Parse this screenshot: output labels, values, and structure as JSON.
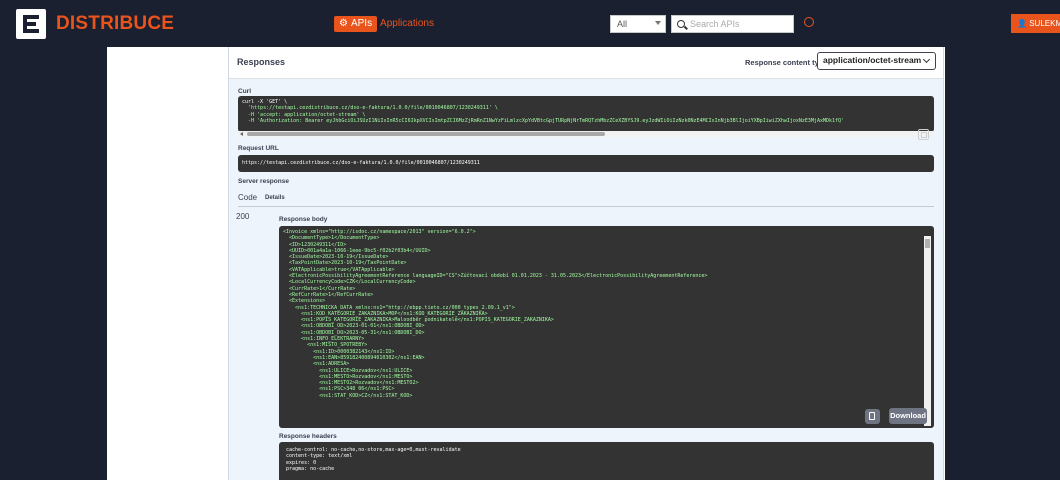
{
  "brand": {
    "name": "DISTRIBUCE"
  },
  "nav": {
    "apis_label": "APIs",
    "applications_label": "Applications"
  },
  "filter": {
    "selected": "All"
  },
  "search": {
    "placeholder": "Search APIs"
  },
  "user": {
    "label": "SULEKMAR"
  },
  "responses": {
    "title": "Responses",
    "content_type_label": "Response content type",
    "content_type_value": "application/octet-stream"
  },
  "curl": {
    "label": "Curl",
    "lines": [
      "curl -X 'GET' \\",
      "  'https://testapi.cezdistribuce.cz/dso-e-faktura/1.0.0/file/0010046807/1230249311' \\",
      "  -H 'accept: application/octet-stream' \\",
      "  -H 'Authorization: Bearer eyJhbGciOiJSUzI1NiIsInR5cCI6IkpXVCIsImtpZCI6MzZjRmRnZ1NwYzFiLmlzcXpYdVBtcGpjTURpNjNrTmRQTzhMbzZCeXZBYSJ9.eyJzdWIiOiIzNzk0NzE4MCIsInNjb3BlIjoiYXBpIiwiZXhwIjoxNzE3MjAxMDk1fQ'"
    ]
  },
  "request_url": {
    "label": "Request URL",
    "value": "https://testapi.cezdistribuce.cz/dso-e-faktura/1.0.0/file/0010046807/1230249311"
  },
  "server_response": {
    "label": "Server response",
    "code_header": "Code",
    "details_header": "Details",
    "code": "200",
    "body_label": "Response body",
    "body_lines": [
      "<Invoice xmlns=\"http://isdoc.cz/namespace/2013\" version=\"6.0.2\">",
      "  <DocumentType>1</DocumentType>",
      "  <ID>1230249311</ID>",
      "  <UUID>001a4a1a-1066-1eee-9bc5-f02b2f03b4</UUID>",
      "  <IssueDate>2023-10-19</IssueDate>",
      "  <TaxPointDate>2023-10-19</TaxPointDate>",
      "  <VATApplicable>true</VATApplicable>",
      "  <ElectronicPossibilityAgreementReference languageID=\"CS\">Zúčtovací období 01.01.2023 - 31.05.2023</ElectronicPossibilityAgreementReference>",
      "  <LocalCurrencyCode>CZK</LocalCurrencyCode>",
      "  <CurrRate>1</CurrRate>",
      "  <RefCurrRate>1</RefCurrRate>",
      "  <Extensions>",
      "    <ns1:TECHNICKA_DATA xmlns:ns1=\"http://ebpp.tieto.cz/000_types_2.09.1_v1\">",
      "      <ns1:KOD_KATEGORIE_ZAKAZNIKA>MOP</ns1:KOD_KATEGORIE_ZAKAZNIKA>",
      "      <ns1:POPIS_KATEGORIE_ZAKAZNIKA>Maloodběr podnikatelé</ns1:POPIS_KATEGORIE_ZAKAZNIKA>",
      "      <ns1:OBDOBI_OD>2023-01-01</ns1:OBDOBI_OD>",
      "      <ns1:OBDOBI_DO>2023-05-31</ns1:OBDOBI_DO>",
      "      <ns1:INFO_ELEKTRARNY>",
      "        <ns1:MISTO_SPOTREBY>",
      "          <ns1:ID>0000382143</ns1:ID>",
      "          <ns1:EAN>859182400894010302</ns1:EAN>",
      "          <ns1:ADRESA>",
      "            <ns1:ULICE>Rozvadov</ns1:ULICE>",
      "            <ns1:MESTO>Rozvadov</ns1:MESTO>",
      "            <ns1:MESTO2>Rozvadov</ns1:MESTO2>",
      "            <ns1:PSC>348 06</ns1:PSC>",
      "            <ns1:STAT_KOD>CZ</ns1:STAT_KOD>"
    ],
    "download_label": "Download",
    "headers_label": "Response headers",
    "headers_lines": [
      " cache-control: no-cache,no-store,max-age=0,must-revalidate",
      " content-type: text/xml",
      " expires: 0",
      " pragma: no-cache"
    ]
  }
}
